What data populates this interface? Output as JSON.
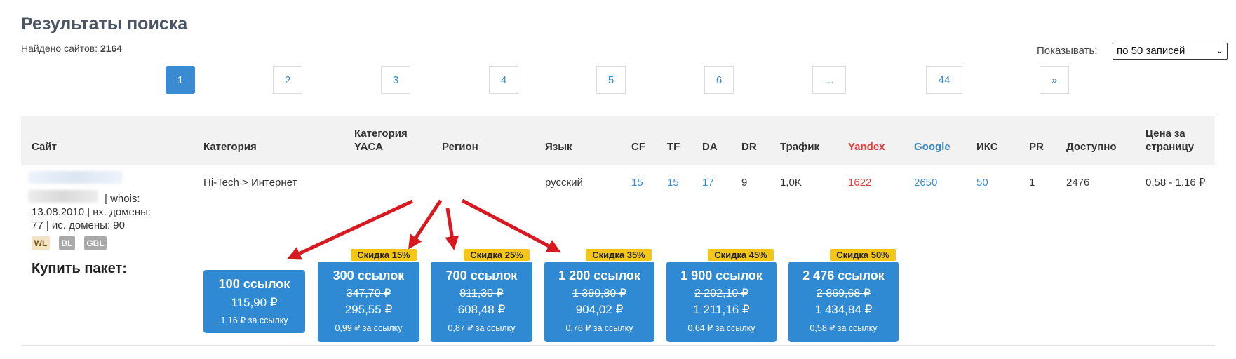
{
  "page": {
    "title": "Результаты поиска",
    "found_label": "Найдено сайтов:",
    "found_count": "2164",
    "show_label": "Показывать:",
    "show_value": "по 50 записей"
  },
  "pagination": [
    "1",
    "2",
    "3",
    "4",
    "5",
    "6",
    "...",
    "44",
    "»"
  ],
  "table": {
    "headers": {
      "site": "Сайт",
      "category": "Категория",
      "yaca": "Категория YACA",
      "region": "Регион",
      "language": "Язык",
      "cf": "CF",
      "tf": "TF",
      "da": "DA",
      "dr": "DR",
      "traffic": "Трафик",
      "yandex": "Yandex",
      "google": "Google",
      "iks": "ИКС",
      "pr": "PR",
      "available": "Доступно",
      "price": "Цена за страницу"
    },
    "row": {
      "whois_suffix": "| whois:",
      "site_line2": "13.08.2010 | вх. домены:",
      "site_line3": "77 | ис. домены: 90",
      "category": "Hi-Tech > Интернет",
      "language": "русский",
      "cf": "15",
      "tf": "15",
      "da": "17",
      "dr": "9",
      "traffic": "1,0K",
      "yandex": "1622",
      "google": "2650",
      "iks": "50",
      "pr": "1",
      "available": "2476",
      "price": "0,58 - 1,16 ₽",
      "badges": [
        "WL",
        "BL",
        "GBL"
      ]
    }
  },
  "buy_label": "Купить пакет:",
  "packages": [
    {
      "links": "100 ссылок",
      "old": "",
      "price": "115,90 ₽",
      "per": "1,16 ₽ за ссылку",
      "discount": ""
    },
    {
      "links": "300 ссылок",
      "old": "347,70 ₽",
      "price": "295,55 ₽",
      "per": "0,99 ₽ за ссылку",
      "discount": "Скидка 15%"
    },
    {
      "links": "700 ссылок",
      "old": "811,30 ₽",
      "price": "608,48 ₽",
      "per": "0,87 ₽ за ссылку",
      "discount": "Скидка 25%"
    },
    {
      "links": "1 200 ссылок",
      "old": "1 390,80 ₽",
      "price": "904,02 ₽",
      "per": "0,76 ₽ за ссылку",
      "discount": "Скидка 35%"
    },
    {
      "links": "1 900 ссылок",
      "old": "2 202,10 ₽",
      "price": "1 211,16 ₽",
      "per": "0,64 ₽ за ссылку",
      "discount": "Скидка 45%"
    },
    {
      "links": "2 476 ссылок",
      "old": "2 869,68 ₽",
      "price": "1 434,84 ₽",
      "per": "0,58 ₽ за ссылку",
      "discount": "Скидка 50%"
    }
  ],
  "colors": {
    "accent": "#3a8bd2",
    "package_bg": "#2f8ad3",
    "discount_bg": "#f5c518",
    "arrow": "#d71920",
    "yandex": "#e0413b",
    "google": "#3a8bc9"
  }
}
